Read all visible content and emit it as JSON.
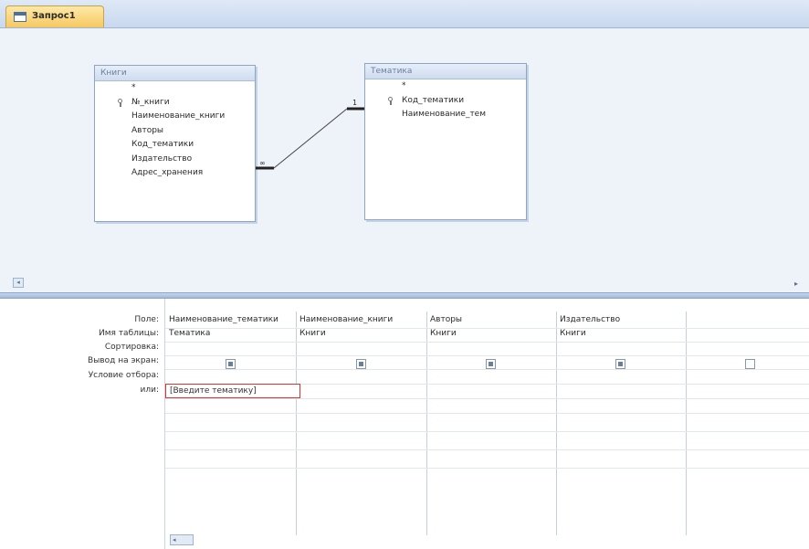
{
  "tab": {
    "title": "Запрос1"
  },
  "tables": [
    {
      "name": "Книги",
      "fields": [
        "*",
        "№_книги",
        "Наименование_книги",
        "Авторы",
        "Код_тематики",
        "Издательство",
        "Адрес_хранения"
      ],
      "key_field_index": 1
    },
    {
      "name": "Тематика",
      "fields": [
        "*",
        "Код_тематики",
        "Наименование_тем"
      ],
      "key_field_index": 1
    }
  ],
  "relationship": {
    "many_symbol": "∞",
    "one_symbol": "1"
  },
  "grid": {
    "row_labels": {
      "field": "Поле:",
      "table": "Имя таблицы:",
      "sort": "Сортировка:",
      "show": "Вывод на экран:",
      "criteria": "Условие отбора:",
      "or": "или:"
    },
    "columns": [
      {
        "field": "Наименование_тематики",
        "table": "Тематика",
        "show": true,
        "criteria": "[Введите тематику]"
      },
      {
        "field": "Наименование_книги",
        "table": "Книги",
        "show": true,
        "criteria": ""
      },
      {
        "field": "Авторы",
        "table": "Книги",
        "show": true,
        "criteria": ""
      },
      {
        "field": "Издательство",
        "table": "Книги",
        "show": true,
        "criteria": ""
      },
      {
        "field": "",
        "table": "",
        "show": false,
        "criteria": ""
      }
    ]
  },
  "icons": {
    "key": "primary-key-icon",
    "scroll_left": "scroll-left-arrow-icon",
    "scroll_right": "scroll-right-arrow-icon"
  }
}
